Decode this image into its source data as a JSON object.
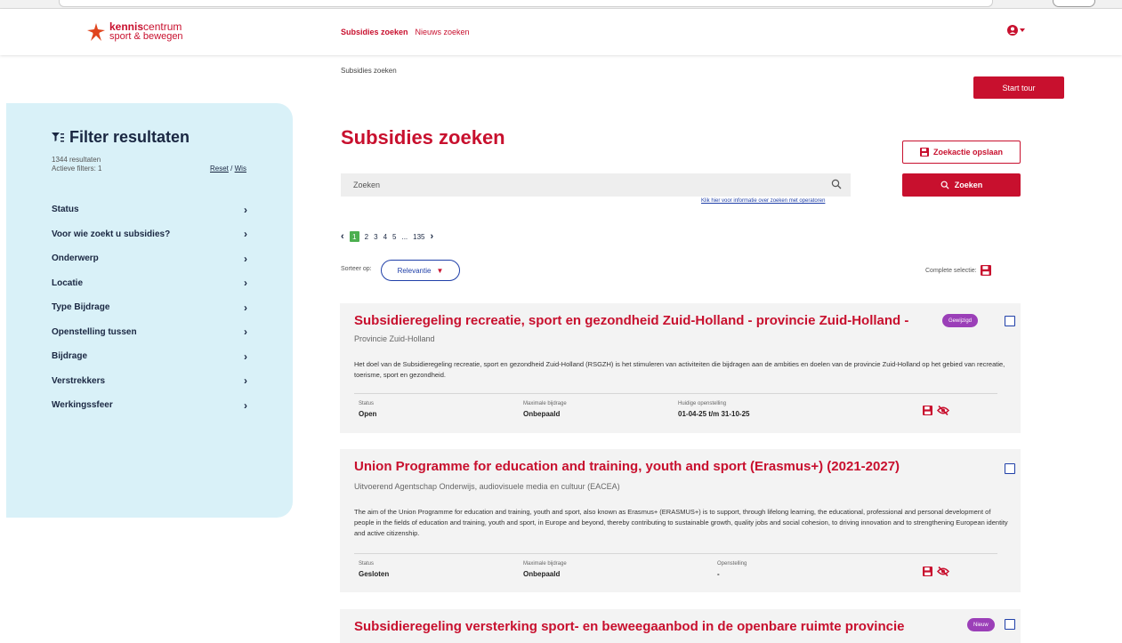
{
  "brand": {
    "logo_word1_bold": "kennis",
    "logo_word1_rest": "centrum",
    "logo_line2": "sport & bewegen"
  },
  "nav": {
    "items": [
      {
        "label": "Subsidies zoeken",
        "active": true
      },
      {
        "label": "Nieuws zoeken",
        "active": false
      }
    ]
  },
  "breadcrumb": "Subsidies zoeken",
  "start_tour_label": "Start tour",
  "sidebar": {
    "title": "Filter resultaten",
    "results_count": "1344 resultaten",
    "active_filters": "Actieve filters: 1",
    "reset_label": "Reset",
    "separator": "/",
    "clear_label": "Wis",
    "filters": [
      {
        "label": "Status"
      },
      {
        "label": "Voor wie zoekt u subsidies?"
      },
      {
        "label": "Onderwerp"
      },
      {
        "label": "Locatie"
      },
      {
        "label": "Type Bijdrage"
      },
      {
        "label": "Openstelling tussen"
      },
      {
        "label": "Bijdrage"
      },
      {
        "label": "Verstrekkers"
      },
      {
        "label": "Werkingssfeer"
      }
    ]
  },
  "main": {
    "title": "Subsidies zoeken",
    "save_search_label": "Zoekactie opslaan",
    "search_placeholder": "Zoeken",
    "search_button_label": "Zoeken",
    "operator_link": "Klik hier voor informatie over zoeken met operatoren",
    "pagination": {
      "prev": "‹",
      "active": "1",
      "pages": [
        "2",
        "3",
        "4",
        "5"
      ],
      "ellipsis": "...",
      "last": "135",
      "next": "›"
    },
    "sort_label": "Sorteer op:",
    "sort_value": "Relevantie",
    "complete_selection_label": "Complete selectie:"
  },
  "results": [
    {
      "title": "Subsidieregeling recreatie, sport en gezondheid Zuid-Holland - provincie Zuid-Holland -",
      "org": "Provincie Zuid-Holland",
      "description": "Het doel van de Subsidieregeling recreatie, sport en gezondheid Zuid-Holland (RSGZH) is het stimuleren van activiteiten die bijdragen aan de ambities en doelen van de provincie Zuid-Holland op het gebied van recreatie, toerisme, sport en gezondheid.",
      "badge": "Gewijzigd",
      "status_label": "Status",
      "status_value": "Open",
      "max_label": "Maximale bijdrage",
      "max_value": "Onbepaald",
      "period_label": "Huidige openstelling",
      "period_value": "01-04-25 t/m 31-10-25"
    },
    {
      "title": "Union Programme for education and training, youth and sport (Erasmus+) (2021-2027)",
      "org": "Uitvoerend Agentschap Onderwijs, audiovisuele media en cultuur (EACEA)",
      "description": "The aim of the Union Programme for education and training, youth and sport, also known as Erasmus+ (ERASMUS+) is to support, through lifelong learning, the educational, professional and personal development of people in the fields of education and training, youth and sport, in Europe and beyond, thereby contributing to sustainable growth, quality jobs and social cohesion, to driving innovation and to strengthening European identity and active citizenship.",
      "badge": "",
      "status_label": "Status",
      "status_value": "Gesloten",
      "max_label": "Maximale bijdrage",
      "max_value": "Onbepaald",
      "period_label": "Openstelling",
      "period_value": "-"
    },
    {
      "title": "Subsidieregeling versterking sport- en beweegaanbod in de openbare ruimte provincie",
      "badge": "Nieuw"
    }
  ],
  "colors": {
    "brand_red": "#c8102e",
    "sidebar_bg": "#d9f1f8",
    "navy": "#1a2742",
    "link_blue": "#1f3fa8",
    "badge_purple": "#9b3fb8",
    "page_active_green": "#4caf50"
  }
}
